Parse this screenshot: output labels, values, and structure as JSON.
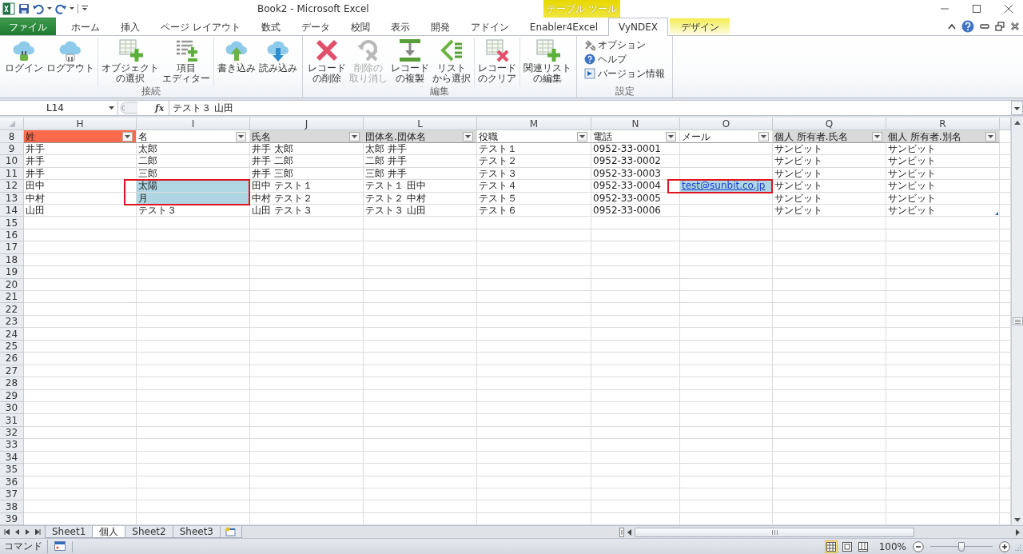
{
  "window": {
    "title": "Book2 - Microsoft Excel"
  },
  "ribbon_tabs": [
    {
      "label": "ファイル",
      "kind": "file",
      "selected": false
    },
    {
      "label": "ホーム",
      "kind": "normal",
      "selected": false
    },
    {
      "label": "挿入",
      "kind": "normal",
      "selected": false
    },
    {
      "label": "ページ レイアウト",
      "kind": "normal",
      "selected": false
    },
    {
      "label": "数式",
      "kind": "normal",
      "selected": false
    },
    {
      "label": "データ",
      "kind": "normal",
      "selected": false
    },
    {
      "label": "校閲",
      "kind": "normal",
      "selected": false
    },
    {
      "label": "表示",
      "kind": "normal",
      "selected": false
    },
    {
      "label": "開発",
      "kind": "normal",
      "selected": false
    },
    {
      "label": "アドイン",
      "kind": "normal",
      "selected": false
    },
    {
      "label": "Enabler4Excel",
      "kind": "normal",
      "selected": false
    },
    {
      "label": "VyNDEX",
      "kind": "normal",
      "selected": true
    },
    {
      "label": "デザイン",
      "kind": "contextual",
      "selected": false
    }
  ],
  "contextual_group": {
    "label": "テーブル ツール"
  },
  "ribbon_groups": [
    {
      "label": "接続",
      "kind": "large",
      "sections": [
        [
          {
            "lines": [
              "ログイン"
            ],
            "disabled": false
          },
          {
            "lines": [
              "ログアウト"
            ],
            "disabled": false
          }
        ],
        [
          {
            "lines": [
              "オブジェクト",
              "の選択"
            ],
            "disabled": false
          },
          {
            "lines": [
              "項目",
              "エディター"
            ],
            "disabled": false
          }
        ],
        [
          {
            "lines": [
              "書き込み"
            ],
            "disabled": false
          },
          {
            "lines": [
              "読み込み"
            ],
            "disabled": false
          }
        ]
      ]
    },
    {
      "label": "編集",
      "kind": "large",
      "sections": [
        [
          {
            "lines": [
              "レコード",
              "の削除"
            ],
            "disabled": false
          },
          {
            "lines": [
              "削除の",
              "取り消し"
            ],
            "disabled": true
          },
          {
            "lines": [
              "レコード",
              "の複製"
            ],
            "disabled": false
          },
          {
            "lines": [
              "リスト",
              "から選択"
            ],
            "disabled": false
          }
        ],
        [
          {
            "lines": [
              "レコード",
              "のクリア"
            ],
            "disabled": false
          }
        ],
        [
          {
            "lines": [
              "関連リスト",
              "の編集"
            ],
            "disabled": false
          }
        ]
      ]
    },
    {
      "label": "設定",
      "kind": "small",
      "items": [
        "オプション",
        "ヘルプ",
        "バージョン情報"
      ]
    }
  ],
  "formula_bar": {
    "name_box": "L14",
    "fx_button": "fx",
    "formula": "テスト３ 山田"
  },
  "sheet": {
    "columns": [
      "H",
      "I",
      "J",
      "L",
      "M",
      "N",
      "O",
      "Q",
      "R"
    ],
    "header_row": {
      "number": "8",
      "cells": [
        {
          "text": "姓",
          "color": "#fc6a4c"
        },
        {
          "text": "名",
          "color": "#ffffff"
        },
        {
          "text": "氏名",
          "color": "#d9d9d9"
        },
        {
          "text": "団体名.団体名",
          "color": "#d9d9d9"
        },
        {
          "text": "役職",
          "color": "#ffffff"
        },
        {
          "text": "電話",
          "color": "#ffffff"
        },
        {
          "text": "メール",
          "color": "#ffffff"
        },
        {
          "text": "個人 所有者.氏名",
          "color": "#d9d9d9"
        },
        {
          "text": "個人 所有者.別名",
          "color": "#d9d9d9"
        }
      ]
    },
    "rows": [
      {
        "number": "9",
        "cells": [
          {
            "text": "井手",
            "kind": "text",
            "highlighted": false,
            "outlined": false
          },
          {
            "text": "太郎",
            "kind": "text",
            "highlighted": false,
            "outlined": false
          },
          {
            "text": "井手 太郎",
            "kind": "text",
            "highlighted": false,
            "outlined": false
          },
          {
            "text": "太郎 井手",
            "kind": "text",
            "highlighted": false,
            "outlined": false
          },
          {
            "text": "テスト１",
            "kind": "text",
            "highlighted": false,
            "outlined": false
          },
          {
            "text": "0952-33-0001",
            "kind": "text",
            "highlighted": false,
            "outlined": false
          },
          {
            "kind": "text",
            "highlighted": false,
            "outlined": false
          },
          {
            "text": "サンビット",
            "kind": "text",
            "highlighted": false,
            "outlined": false
          },
          {
            "text": "サンビット",
            "kind": "text",
            "highlighted": false,
            "outlined": false
          }
        ]
      },
      {
        "number": "10",
        "cells": [
          {
            "text": "井手",
            "kind": "text",
            "highlighted": false,
            "outlined": false
          },
          {
            "text": "二郎",
            "kind": "text",
            "highlighted": false,
            "outlined": false
          },
          {
            "text": "井手 二郎",
            "kind": "text",
            "highlighted": false,
            "outlined": false
          },
          {
            "text": "二郎 井手",
            "kind": "text",
            "highlighted": false,
            "outlined": false
          },
          {
            "text": "テスト２",
            "kind": "text",
            "highlighted": false,
            "outlined": false
          },
          {
            "text": "0952-33-0002",
            "kind": "text",
            "highlighted": false,
            "outlined": false
          },
          {
            "kind": "text",
            "highlighted": false,
            "outlined": false
          },
          {
            "text": "サンビット",
            "kind": "text",
            "highlighted": false,
            "outlined": false
          },
          {
            "text": "サンビット",
            "kind": "text",
            "highlighted": false,
            "outlined": false
          }
        ]
      },
      {
        "number": "11",
        "cells": [
          {
            "text": "井手",
            "kind": "text",
            "highlighted": false,
            "outlined": false
          },
          {
            "text": "三郎",
            "kind": "text",
            "highlighted": false,
            "outlined": false
          },
          {
            "text": "井手 三郎",
            "kind": "text",
            "highlighted": false,
            "outlined": false
          },
          {
            "text": "三郎 井手",
            "kind": "text",
            "highlighted": false,
            "outlined": false
          },
          {
            "text": "テスト３",
            "kind": "text",
            "highlighted": false,
            "outlined": false
          },
          {
            "text": "0952-33-0003",
            "kind": "text",
            "highlighted": false,
            "outlined": false
          },
          {
            "kind": "text",
            "highlighted": false,
            "outlined": false
          },
          {
            "text": "サンビット",
            "kind": "text",
            "highlighted": false,
            "outlined": false
          },
          {
            "text": "サンビット",
            "kind": "text",
            "highlighted": false,
            "outlined": false
          }
        ]
      },
      {
        "number": "12",
        "cells": [
          {
            "text": "田中",
            "kind": "text",
            "highlighted": false,
            "outlined": false
          },
          {
            "text": "太陽",
            "kind": "text",
            "highlighted": true,
            "outlined": true
          },
          {
            "text": "田中 テスト１",
            "kind": "text",
            "highlighted": false,
            "outlined": false
          },
          {
            "text": "テスト１ 田中",
            "kind": "text",
            "highlighted": false,
            "outlined": false
          },
          {
            "text": "テスト４",
            "kind": "text",
            "highlighted": false,
            "outlined": false
          },
          {
            "text": "0952-33-0004",
            "kind": "text",
            "highlighted": false,
            "outlined": false
          },
          {
            "text": "test@sunbit.co.jp",
            "kind": "link",
            "highlighted": true,
            "outlined": true
          },
          {
            "text": "サンビット",
            "kind": "text",
            "highlighted": false,
            "outlined": false
          },
          {
            "text": "サンビット",
            "kind": "text",
            "highlighted": false,
            "outlined": false
          }
        ]
      },
      {
        "number": "13",
        "cells": [
          {
            "text": "中村",
            "kind": "text",
            "highlighted": false,
            "outlined": false
          },
          {
            "text": "月",
            "kind": "text",
            "highlighted": true,
            "outlined": true
          },
          {
            "text": "中村 テスト２",
            "kind": "text",
            "highlighted": false,
            "outlined": false
          },
          {
            "text": "テスト２ 中村",
            "kind": "text",
            "highlighted": false,
            "outlined": false
          },
          {
            "text": "テスト５",
            "kind": "text",
            "highlighted": false,
            "outlined": false
          },
          {
            "text": "0952-33-0005",
            "kind": "text",
            "highlighted": false,
            "outlined": false
          },
          {
            "kind": "text",
            "highlighted": false,
            "outlined": false
          },
          {
            "text": "サンビット",
            "kind": "text",
            "highlighted": false,
            "outlined": false
          },
          {
            "text": "サンビット",
            "kind": "text",
            "highlighted": false,
            "outlined": false
          }
        ]
      },
      {
        "number": "14",
        "cells": [
          {
            "text": "山田",
            "kind": "text",
            "highlighted": false,
            "outlined": false
          },
          {
            "text": "テスト３",
            "kind": "text",
            "highlighted": false,
            "outlined": false
          },
          {
            "text": "山田 テスト３",
            "kind": "text",
            "highlighted": false,
            "outlined": false
          },
          {
            "text": "テスト３ 山田",
            "kind": "text",
            "highlighted": false,
            "outlined": false
          },
          {
            "text": "テスト６",
            "kind": "text",
            "highlighted": false,
            "outlined": false
          },
          {
            "text": "0952-33-0006",
            "kind": "text",
            "highlighted": false,
            "outlined": false
          },
          {
            "kind": "text",
            "highlighted": false,
            "outlined": false
          },
          {
            "text": "サンビット",
            "kind": "text",
            "highlighted": false,
            "outlined": false
          },
          {
            "text": "サンビット",
            "kind": "text",
            "highlighted": false,
            "outlined": false
          }
        ]
      }
    ],
    "empty_rows": [
      "15",
      "16",
      "17",
      "18",
      "19",
      "20",
      "21",
      "22",
      "23",
      "24",
      "25",
      "26",
      "27",
      "28",
      "29",
      "30",
      "31",
      "32",
      "33",
      "34",
      "35",
      "36",
      "37",
      "38",
      "39"
    ]
  },
  "sheet_tabs": [
    {
      "label": "Sheet1",
      "selected": false
    },
    {
      "label": "個人",
      "selected": true
    },
    {
      "label": "Sheet2",
      "selected": false
    },
    {
      "label": "Sheet3",
      "selected": false
    }
  ],
  "status_bar": {
    "mode": "コマンド",
    "views": [
      {
        "selected": true
      },
      {
        "selected": false
      },
      {
        "selected": false
      }
    ],
    "zoom": "100%",
    "zoom_slider": {
      "level": 0.5
    }
  }
}
